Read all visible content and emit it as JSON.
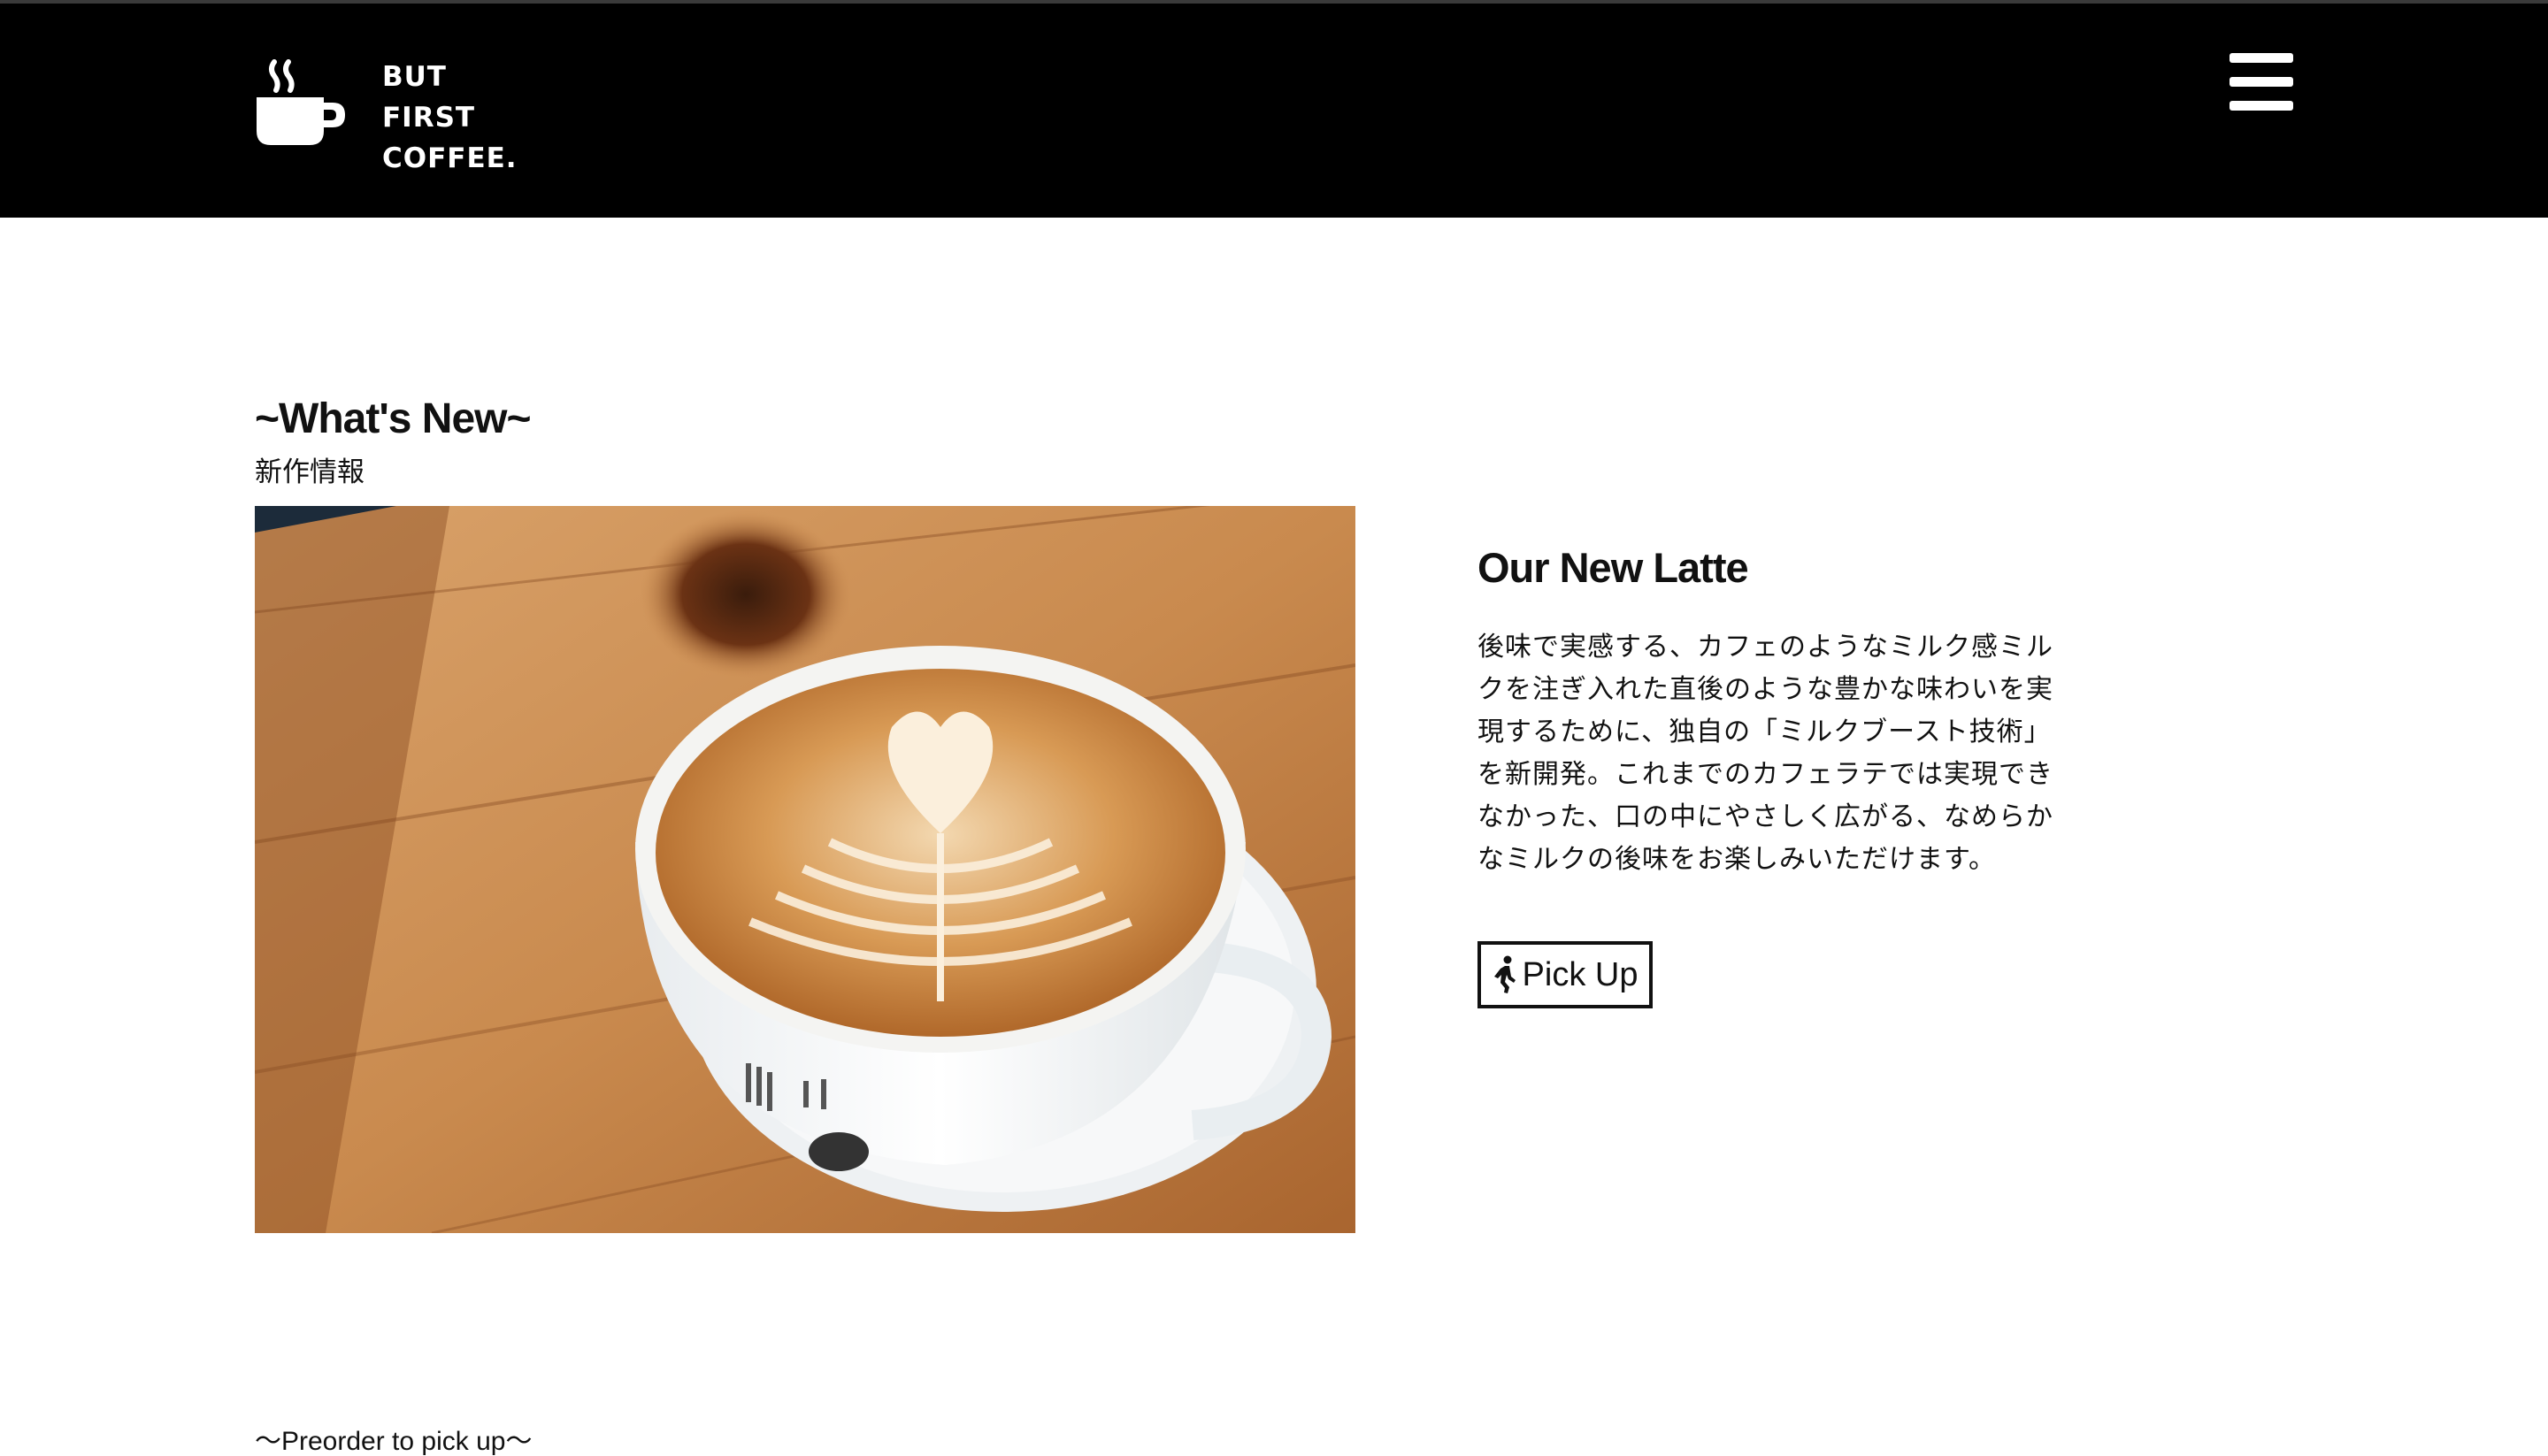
{
  "header": {
    "brand_line1": "BUT",
    "brand_line2": "FIRST",
    "brand_line3": "COFFEE.",
    "menu_icon": "hamburger-menu-icon",
    "logo_icon": "coffee-cup-icon"
  },
  "whats_new": {
    "title": "~What's New~",
    "subtitle": "新作情報",
    "image_alt": "latte art coffee cup on wooden table"
  },
  "product": {
    "title": "Our New Latte",
    "description": "後味で実感する、カフェのようなミルク感ミルクを注ぎ入れた直後のような豊かな味わいを実現するために、独自の「ミルクブースト技術」を新開発。これまでのカフェラテでは実現できなかった、口の中にやさしく広がる、なめらかなミルクの後味をお楽しみいただけます。",
    "button_label": "Pick Up",
    "button_icon": "walking-person-icon"
  },
  "preorder": {
    "text": "〜Preorder to pick up〜"
  },
  "colors": {
    "header_bg": "#000000",
    "text": "#111111",
    "page_bg": "#ffffff"
  }
}
